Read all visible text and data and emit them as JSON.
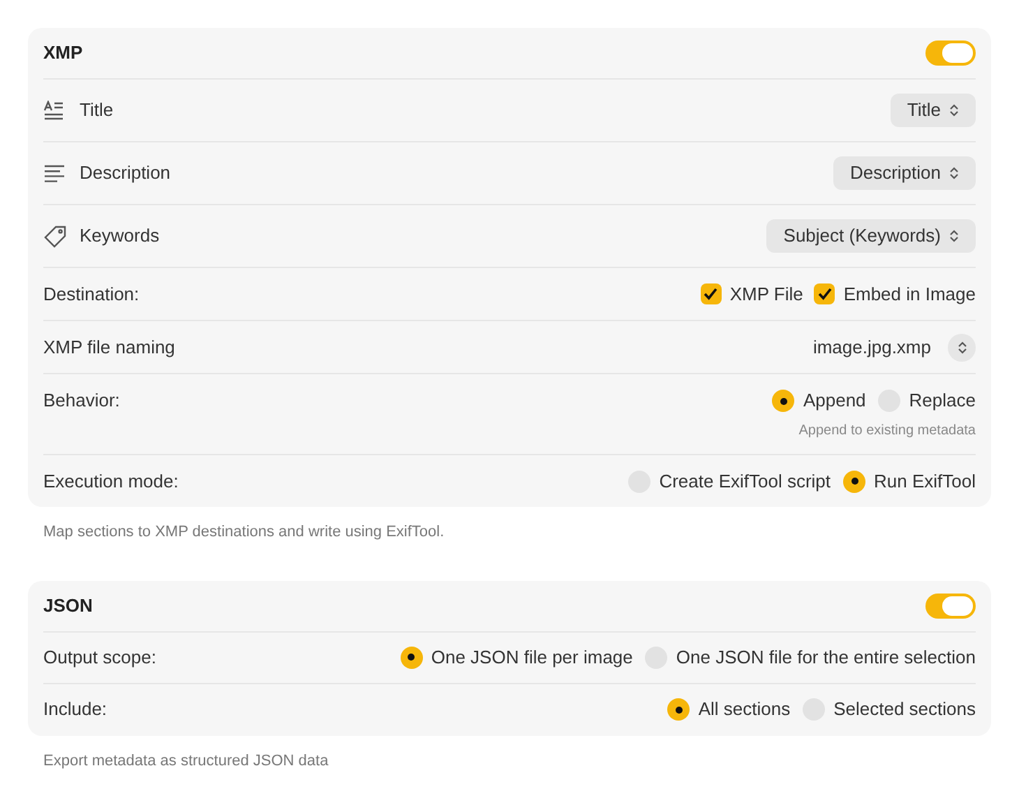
{
  "sections": [
    {
      "title": "XMP",
      "enabled": true,
      "rows": [
        {
          "kind": "mapping",
          "label": "Title",
          "popup": "Title"
        },
        {
          "kind": "mapping",
          "label": "Description",
          "popup": "Description"
        },
        {
          "kind": "mapping",
          "label": "Keywords",
          "popup": "Subject (Keywords)"
        },
        {
          "kind": "checkboxes",
          "label": "Destination:",
          "options": [
            {
              "label": "XMP File",
              "checked": true
            },
            {
              "label": "Embed in Image",
              "checked": true
            }
          ]
        },
        {
          "kind": "stepper",
          "label": "XMP file naming",
          "value": "image.jpg.xmp"
        },
        {
          "kind": "radios",
          "label": "Behavior:",
          "options": [
            {
              "label": "Append",
              "selected": true
            },
            {
              "label": "Replace",
              "selected": false
            }
          ],
          "note": "Append to existing metadata"
        },
        {
          "kind": "radios",
          "label": "Execution mode:",
          "options": [
            {
              "label": "Create ExifTool script",
              "selected": false
            },
            {
              "label": "Run ExifTool",
              "selected": true
            }
          ]
        }
      ],
      "footer": "Map sections to XMP destinations and write using ExifTool."
    },
    {
      "title": "JSON",
      "enabled": true,
      "rows": [
        {
          "kind": "radios",
          "label": "Output scope:",
          "options": [
            {
              "label": "One JSON file per image",
              "selected": true
            },
            {
              "label": "One JSON file for the entire selection",
              "selected": false
            }
          ]
        },
        {
          "kind": "radios",
          "label": "Include:",
          "options": [
            {
              "label": "All sections",
              "selected": true
            },
            {
              "label": "Selected sections",
              "selected": false
            }
          ]
        }
      ],
      "footer": "Export metadata as structured JSON data"
    }
  ]
}
